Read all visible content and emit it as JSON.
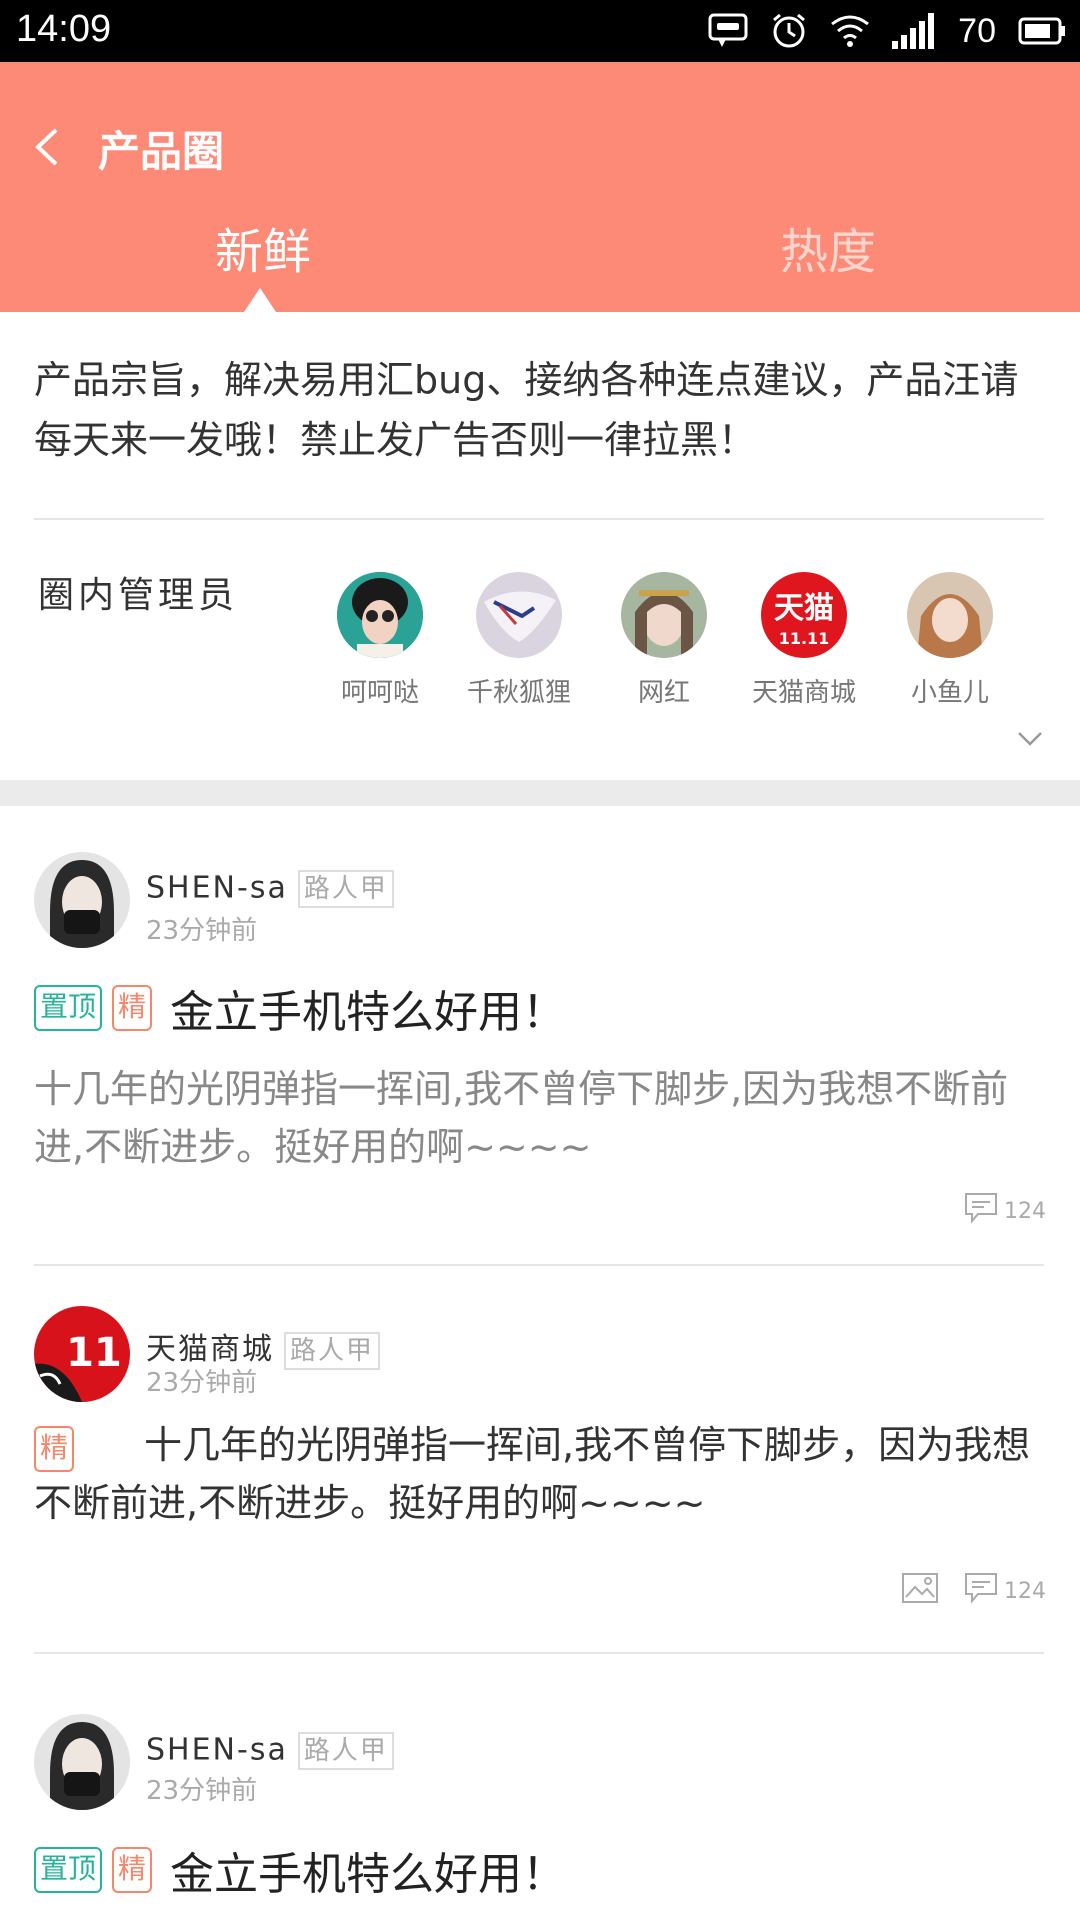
{
  "status_bar": {
    "time": "14:09",
    "battery": "70",
    "icons": [
      "message-icon",
      "alarm-icon",
      "wifi-icon",
      "signal-icon",
      "battery-icon"
    ]
  },
  "header": {
    "title": "产品圈",
    "tabs": [
      {
        "label": "新鲜",
        "active": true
      },
      {
        "label": "热度",
        "active": false
      }
    ],
    "background_color": "#fd8a77"
  },
  "description": "产品宗旨，解决易用汇bug、接纳各种连点建议，产品汪请每天来一发哦！禁止发广告否则一律拉黑！",
  "admins": {
    "label": "圈内管理员",
    "items": [
      {
        "name": "呵呵哒"
      },
      {
        "name": "千秋狐狸"
      },
      {
        "name": "网红"
      },
      {
        "name": "天猫商城"
      },
      {
        "name": "小鱼儿"
      }
    ]
  },
  "posts": [
    {
      "author": "SHEN-sa",
      "role": "路人甲",
      "time": "23分钟前",
      "tags": [
        "置顶",
        "精"
      ],
      "title": "金立手机特么好用！",
      "body": "十几年的光阴弹指一挥间,我不曾停下脚步,因为我想不断前进,不断进步。挺好用的啊~~~~",
      "comments": "124"
    },
    {
      "author": "天猫商城",
      "role": "路人甲",
      "time": "23分钟前",
      "tags": [
        "精"
      ],
      "body": "十几年的光阴弹指一挥间,我不曾停下脚步，因为我想不断前进,不断进步。挺好用的啊~~~~",
      "comments": "124",
      "has_image": true
    },
    {
      "author": "SHEN-sa",
      "role": "路人甲",
      "time": "23分钟前",
      "tags": [
        "置顶",
        "精"
      ],
      "title": "金立手机特么好用！"
    }
  ],
  "colors": {
    "accent": "#fd8a77",
    "tag_top": "#25b39a",
    "tag_essence": "#f5876d"
  }
}
